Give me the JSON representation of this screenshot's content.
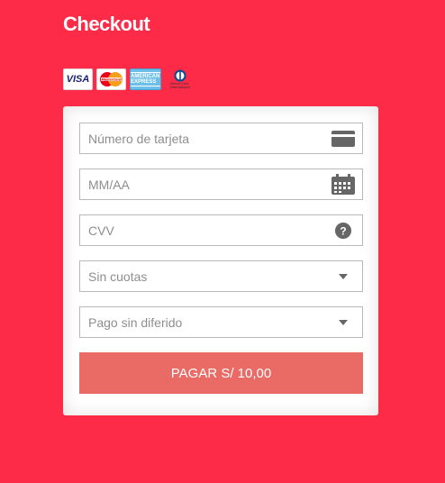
{
  "header": {
    "title": "Checkout"
  },
  "card_logos": {
    "visa": "VISA",
    "mastercard": "MasterCard",
    "amex": "AMERICAN EXPRESS",
    "diners": "Diners Club International"
  },
  "form": {
    "card_number_placeholder": "Número de tarjeta",
    "expiry_placeholder": "MM/AA",
    "cvv_placeholder": "CVV",
    "installments_value": "Sin cuotas",
    "deferred_value": "Pago sin diferido",
    "pay_label": "PAGAR S/ 10,00"
  },
  "colors": {
    "background": "#fd2a48",
    "button": "#ea6a66",
    "icon": "#666666"
  },
  "icons": [
    "credit-card-icon",
    "calendar-icon",
    "help-icon",
    "chevron-down-icon"
  ]
}
